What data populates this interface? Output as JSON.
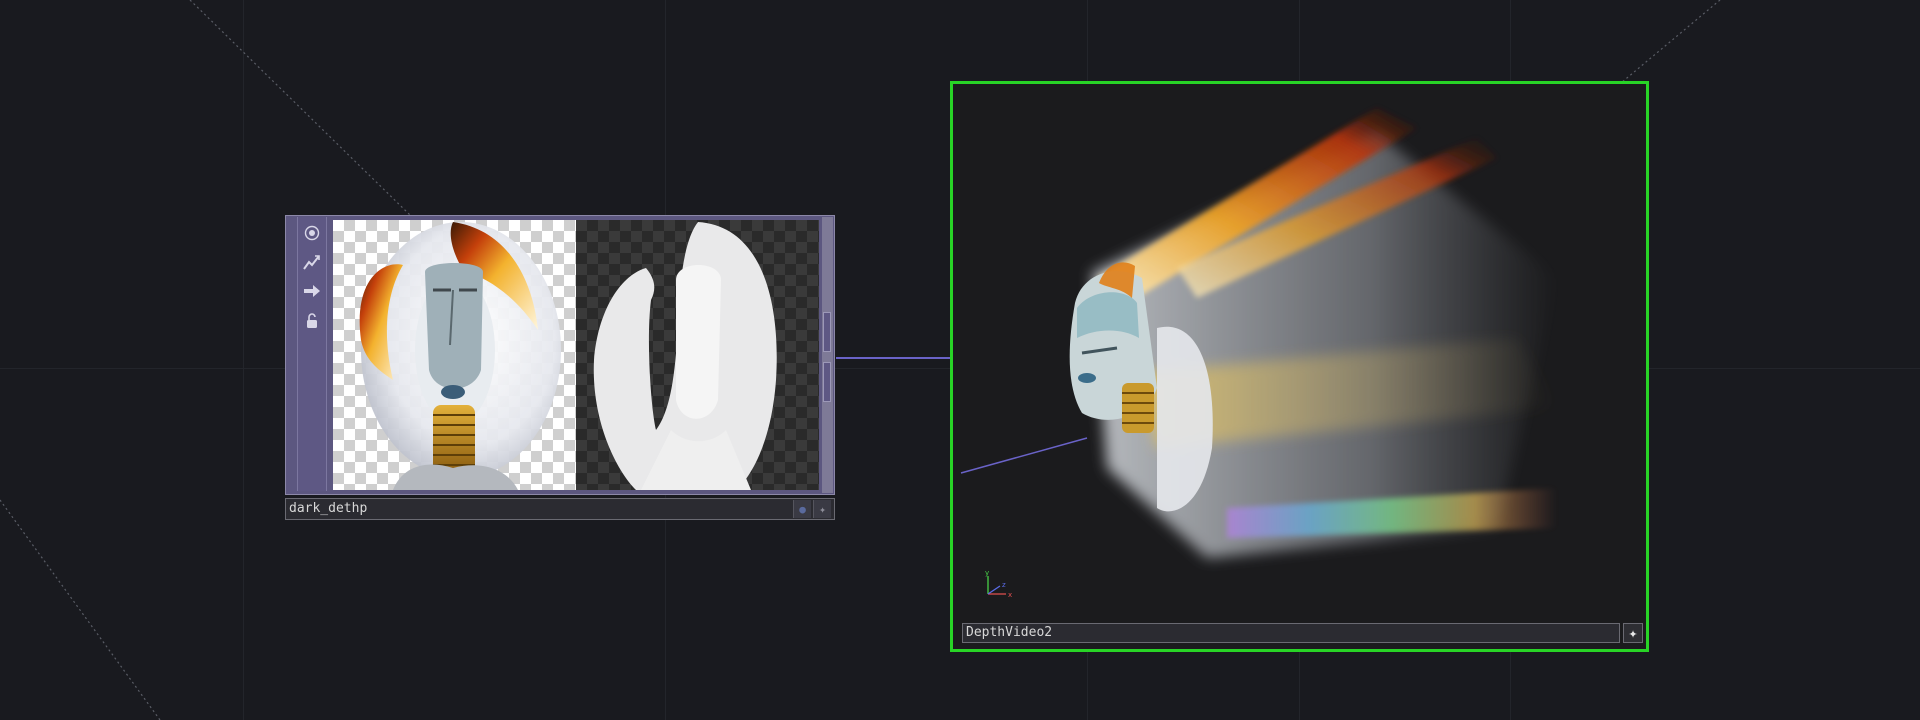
{
  "operators": {
    "left": {
      "name": "dark_dethp",
      "icons": [
        "viewer-toggle-icon",
        "cook-flag-icon",
        "bypass-arrow-icon",
        "lock-icon"
      ]
    },
    "right": {
      "name": "DepthVideo2",
      "selected": true
    }
  },
  "axis_gizmo": {
    "x": "x",
    "y": "y",
    "z": "z"
  },
  "colors": {
    "background": "#191a1f",
    "selection_outline": "#28d426",
    "operator_body": "#5c5780",
    "wire": "#6a63c8"
  }
}
